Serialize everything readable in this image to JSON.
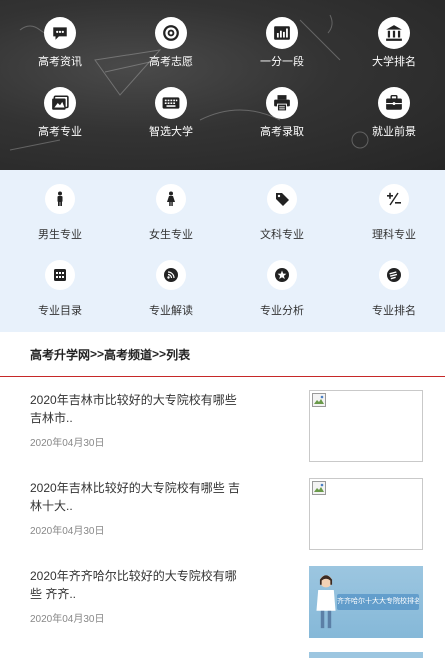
{
  "top_nav": {
    "items": [
      {
        "label": "高考资讯",
        "icon": "chat-bubble-icon"
      },
      {
        "label": "高考志愿",
        "icon": "target-icon"
      },
      {
        "label": "一分一段",
        "icon": "bar-chart-icon"
      },
      {
        "label": "大学排名",
        "icon": "university-icon"
      },
      {
        "label": "高考专业",
        "icon": "image-stack-icon"
      },
      {
        "label": "智选大学",
        "icon": "keyboard-icon"
      },
      {
        "label": "高考录取",
        "icon": "printer-icon"
      },
      {
        "label": "就业前景",
        "icon": "briefcase-icon"
      }
    ]
  },
  "categories": {
    "items": [
      {
        "label": "男生专业",
        "icon": "male-icon"
      },
      {
        "label": "女生专业",
        "icon": "female-icon"
      },
      {
        "label": "文科专业",
        "icon": "tag-icon"
      },
      {
        "label": "理科专业",
        "icon": "plus-minus-icon"
      },
      {
        "label": "专业目录",
        "icon": "grid-icon"
      },
      {
        "label": "专业解读",
        "icon": "feed-icon"
      },
      {
        "label": "专业分析",
        "icon": "star-circle-icon"
      },
      {
        "label": "专业排名",
        "icon": "chart-badge-icon"
      }
    ]
  },
  "breadcrumb": {
    "home": "高考升学网",
    "sep1": ">>",
    "channel": "高考频道",
    "sep2": ">>",
    "current": "列表"
  },
  "articles": [
    {
      "title": "2020年吉林市比较好的大专院校有哪些 吉林市..",
      "date": "2020年04月30日",
      "thumb": "broken"
    },
    {
      "title": "2020年吉林比较好的大专院校有哪些 吉林十大..",
      "date": "2020年04月30日",
      "thumb": "broken"
    },
    {
      "title": "2020年齐齐哈尔比较好的大专院校有哪些 齐齐..",
      "date": "2020年04月30日",
      "thumb": "image",
      "thumb_text": "齐齐哈尔十大大专院校排名"
    }
  ],
  "colors": {
    "accent_red": "#c62828",
    "panel_blue": "#e8f1fb",
    "icon_dark": "#222222"
  }
}
